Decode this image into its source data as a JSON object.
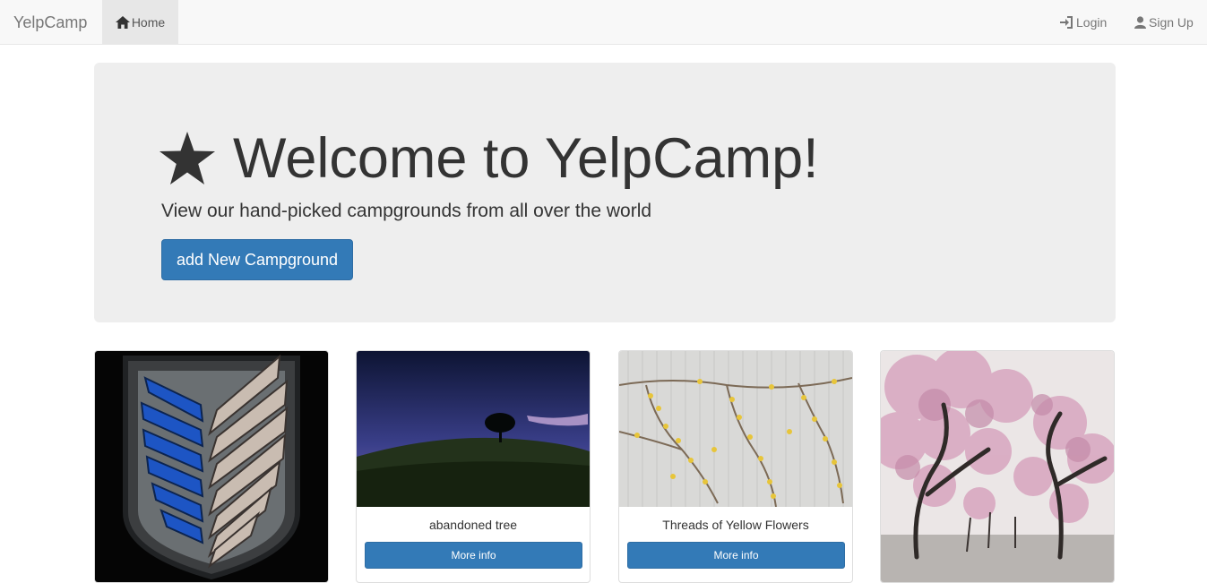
{
  "navbar": {
    "brand": "YelpCamp",
    "home_label": "Home",
    "home_icon": "home-icon",
    "login_label": "Login",
    "login_icon": "log-in-icon",
    "signup_label": "Sign Up",
    "signup_icon": "user-icon",
    "background": "#f8f8f8"
  },
  "jumbotron": {
    "icon": "star-icon",
    "title": "Welcome to YelpCamp!",
    "lead": "View our hand-picked campgrounds from all over the world",
    "button_label": "add New Campground",
    "background": "#eeeeee"
  },
  "campgrounds": [
    {
      "name": "",
      "image": "scout-regiment-wings-emblem",
      "button_label": ""
    },
    {
      "name": "abandoned tree",
      "image": "tree-on-hill-at-dusk",
      "button_label": "More info"
    },
    {
      "name": "Threads of Yellow Flowers",
      "image": "yellow-flower-vines-on-wall",
      "button_label": "More info"
    },
    {
      "name": "",
      "image": "cherry-blossom-trees",
      "button_label": ""
    }
  ],
  "colors": {
    "primary": "#337ab7",
    "primary_border": "#2e6da4",
    "text": "#333333",
    "nav_text": "#777777"
  }
}
